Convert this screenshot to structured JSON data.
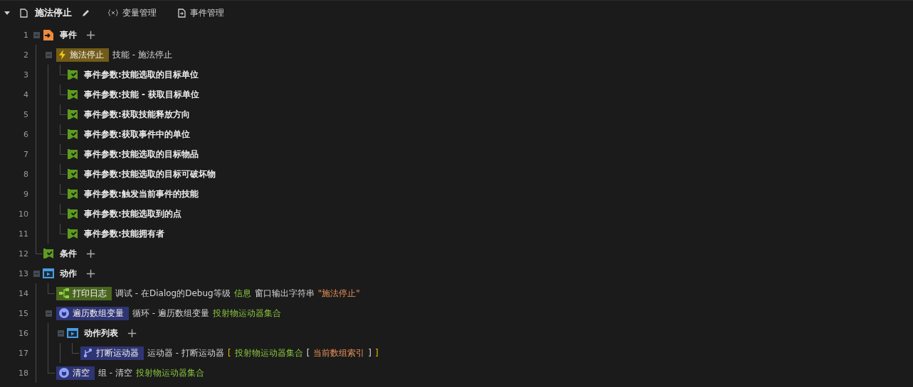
{
  "header": {
    "expanded": true,
    "title": "施法停止",
    "tabs": [
      {
        "kind": "variables",
        "label": "变量管理"
      },
      {
        "kind": "events",
        "label": "事件管理"
      }
    ]
  },
  "nodes": [
    {
      "line": "1",
      "kind": "event-section",
      "label": "事件",
      "add": "+",
      "expanded": true,
      "children": [
        {
          "line": "2",
          "kind": "trigger",
          "label": "施法停止",
          "color": "#725c17",
          "desc": [
            {
              "kind": "plain",
              "text": "技能 - 施法停止"
            }
          ],
          "expanded": true,
          "children": [
            {
              "line": "3",
              "kind": "param",
              "label": "事件参数:技能选取的目标单位"
            },
            {
              "line": "4",
              "kind": "param",
              "label": "事件参数:技能 - 获取目标单位"
            },
            {
              "line": "5",
              "kind": "param",
              "label": "事件参数:获取技能释放方向"
            },
            {
              "line": "6",
              "kind": "param",
              "label": "事件参数:获取事件中的单位"
            },
            {
              "line": "7",
              "kind": "param",
              "label": "事件参数:技能选取的目标物品"
            },
            {
              "line": "8",
              "kind": "param",
              "label": "事件参数:技能选取的目标可破坏物"
            },
            {
              "line": "9",
              "kind": "param",
              "label": "事件参数:触发当前事件的技能"
            },
            {
              "line": "10",
              "kind": "param",
              "label": "事件参数:技能选取到的点"
            },
            {
              "line": "11",
              "kind": "param",
              "label": "事件参数:技能拥有者"
            }
          ]
        }
      ]
    },
    {
      "line": "12",
      "kind": "condition-section",
      "label": "条件",
      "add": "+"
    },
    {
      "line": "13",
      "kind": "action-section",
      "label": "动作",
      "add": "+",
      "expanded": true,
      "children": [
        {
          "line": "14",
          "kind": "log-action",
          "label": "打印日志",
          "color": "#4a6520",
          "desc": [
            {
              "kind": "plain",
              "text": "调试 - 在Dialog的Debug等级"
            },
            {
              "kind": "value",
              "text": "信息"
            },
            {
              "kind": "plain",
              "text": "窗口输出字符串"
            },
            {
              "kind": "string",
              "text": "\"施法停止\""
            }
          ]
        },
        {
          "line": "15",
          "kind": "loop-action",
          "label": "遍历数组变量",
          "color": "#2f3573",
          "desc": [
            {
              "kind": "plain",
              "text": "循环 - 遍历数组变量"
            },
            {
              "kind": "value",
              "text": "投射物运动器集合"
            }
          ],
          "expanded": true,
          "children": [
            {
              "line": "16",
              "kind": "list-section",
              "label": "动作列表",
              "add": "+",
              "expanded": true,
              "children": [
                {
                  "line": "17",
                  "kind": "mover-action",
                  "label": "打断运动器",
                  "color": "#2f3573",
                  "desc": [
                    {
                      "kind": "plain",
                      "text": "运动器 - 打断运动器"
                    },
                    {
                      "kind": "bracket",
                      "text": "["
                    },
                    {
                      "kind": "value",
                      "text": "投射物运动器集合"
                    },
                    {
                      "kind": "plain",
                      "text": "["
                    },
                    {
                      "kind": "string",
                      "text": "当前数组索引"
                    },
                    {
                      "kind": "plain",
                      "text": "]"
                    },
                    {
                      "kind": "bracket",
                      "text": "]"
                    }
                  ]
                }
              ]
            }
          ]
        },
        {
          "line": "18",
          "kind": "clear-action",
          "label": "清空",
          "color": "#2f3573",
          "desc": [
            {
              "kind": "plain",
              "text": "组 - 清空"
            },
            {
              "kind": "value",
              "text": "投射物运动器集合"
            }
          ]
        }
      ]
    }
  ]
}
